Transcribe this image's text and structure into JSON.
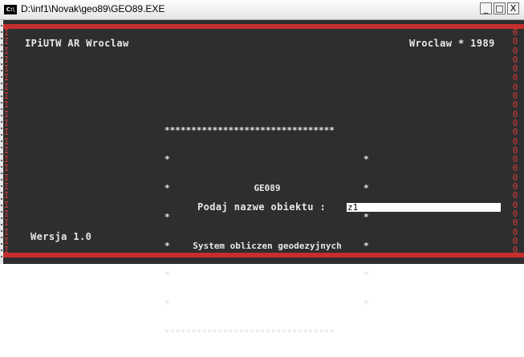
{
  "window": {
    "title": "D:\\inf1\\Novak\\geo89\\GEO89.EXE",
    "icon_label": "C:\\",
    "icon": "console-app-icon",
    "buttons": {
      "minimize": "_",
      "maximize": "□",
      "close": "X"
    }
  },
  "console": {
    "left_edge_char": "I",
    "right_edge_char": "0",
    "header_left": "IPiUTW AR Wroclaw",
    "header_right": "Wroclaw * 1989",
    "banner": {
      "border": "********************************",
      "star": "*",
      "app_name": "GE089",
      "subtitle": "System obliczen geodezyjnych"
    },
    "prompt_label": "Podaj nazwe obiektu :",
    "input_value": "z1",
    "version": "Wersja 1.0"
  },
  "colors": {
    "console_bg": "#2e2e2e",
    "border_red": "#c62e2e",
    "text": "#e8e8e8"
  }
}
